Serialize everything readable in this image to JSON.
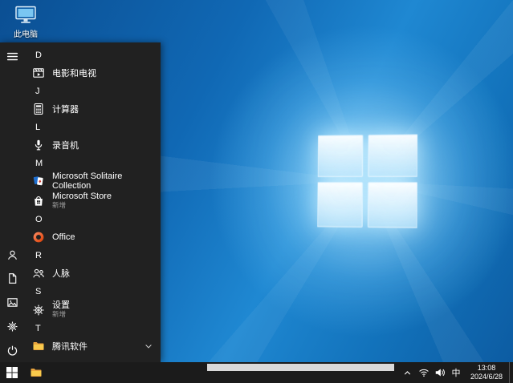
{
  "desktop": {
    "this_pc": {
      "label": "此电脑",
      "icon": "monitor-icon"
    }
  },
  "start_menu": {
    "section_letters": [
      "D",
      "J",
      "L",
      "M",
      "O",
      "R",
      "S",
      "T"
    ],
    "apps": {
      "movies_tv": {
        "label": "电影和电视",
        "icon": "movies-tv-icon"
      },
      "calculator": {
        "label": "计算器",
        "icon": "calculator-icon"
      },
      "voice_recorder": {
        "label": "录音机",
        "icon": "microphone-icon"
      },
      "solitaire": {
        "label": "Microsoft Solitaire Collection",
        "icon": "solitaire-cards-icon"
      },
      "store": {
        "label": "Microsoft Store",
        "subtitle": "新增",
        "icon": "store-bag-icon"
      },
      "office": {
        "label": "Office",
        "icon": "office-icon"
      },
      "people": {
        "label": "人脉",
        "icon": "people-icon"
      },
      "settings": {
        "label": "设置",
        "subtitle": "新增",
        "icon": "gear-icon"
      },
      "tencent": {
        "label": "腾讯软件",
        "icon": "folder-icon",
        "expandable": true
      }
    },
    "rail_icons": [
      "hamburger-menu-icon",
      "user-icon",
      "documents-icon",
      "pictures-icon",
      "gear-icon",
      "power-icon"
    ]
  },
  "taskbar": {
    "time": "13:08",
    "date": "2024/6/28",
    "ime": "中",
    "tray_icons": [
      "chevron-up-icon",
      "network-icon",
      "volume-icon"
    ],
    "buttons": [
      "start-button",
      "file-explorer-button"
    ]
  },
  "colors": {
    "wallpaper_blue": "#1f88d2",
    "menu_bg": "#212121",
    "taskbar_bg": "#1b1b1b",
    "folder_yellow": "#f8c94c",
    "office_orange": "#d83b01",
    "card_blue": "#1f6fd0"
  }
}
